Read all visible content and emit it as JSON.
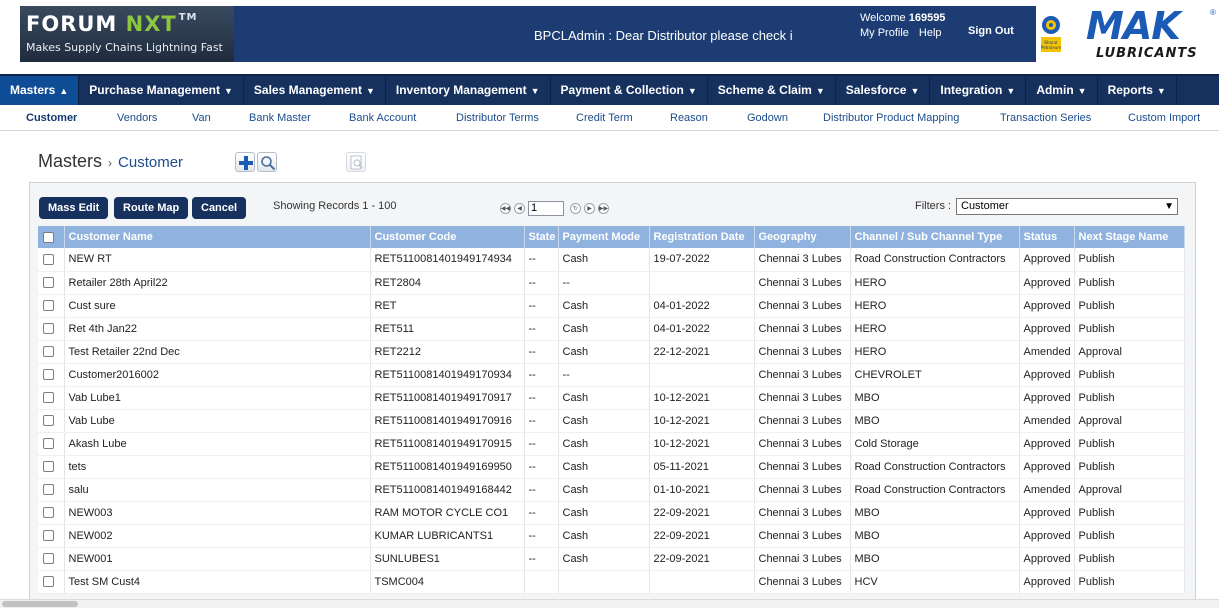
{
  "header": {
    "brand_main": "FORUM",
    "brand_accent": "NXT",
    "brand_tm": "TM",
    "brand_tagline": "Makes Supply Chains Lightning Fast",
    "marquee": "BPCLAdmin : Dear Distributor please check i",
    "welcome_prefix": "Welcome",
    "user_id": "169595",
    "my_profile": "My Profile",
    "help": "Help",
    "sign_out": "Sign Out",
    "partner_logo_text": "MAK",
    "partner_logo_sub": "LUBRICANTS",
    "partner_reg": "®",
    "bp_logo_text": "Bharat Petroleum"
  },
  "main_nav": [
    {
      "label": "Masters",
      "caret": "▲",
      "active": true
    },
    {
      "label": "Purchase Management",
      "caret": "▼"
    },
    {
      "label": "Sales Management",
      "caret": "▼"
    },
    {
      "label": "Inventory Management",
      "caret": "▼"
    },
    {
      "label": "Payment & Collection",
      "caret": "▼"
    },
    {
      "label": "Scheme & Claim",
      "caret": "▼"
    },
    {
      "label": "Salesforce",
      "caret": "▼"
    },
    {
      "label": "Integration",
      "caret": "▼"
    },
    {
      "label": "Admin",
      "caret": "▼"
    },
    {
      "label": "Reports",
      "caret": "▼"
    }
  ],
  "sub_nav": [
    {
      "label": "Customer",
      "active": true
    },
    {
      "label": "Vendors"
    },
    {
      "label": "Van"
    },
    {
      "label": "Bank Master"
    },
    {
      "label": "Bank Account"
    },
    {
      "label": "Distributor Terms"
    },
    {
      "label": "Credit Term"
    },
    {
      "label": "Reason"
    },
    {
      "label": "Godown"
    },
    {
      "label": "Distributor Product Mapping"
    },
    {
      "label": "Transaction Series"
    },
    {
      "label": "Custom Import"
    }
  ],
  "breadcrumb": {
    "root": "Masters",
    "arrow": "›",
    "current": "Customer"
  },
  "toolbar": {
    "mass_edit": "Mass Edit",
    "route_map": "Route Map",
    "cancel": "Cancel",
    "records": "Showing Records 1 - 100",
    "page": "1",
    "filters_label": "Filters :",
    "filter_value": "Customer"
  },
  "columns": [
    "Customer Name",
    "Customer Code",
    "State",
    "Payment Mode",
    "Registration Date",
    "Geography",
    "Channel / Sub Channel Type",
    "Status",
    "Next Stage Name"
  ],
  "rows": [
    [
      "NEW RT",
      "RET5110081401949174934",
      "--",
      "Cash",
      "19-07-2022",
      "Chennai 3 Lubes",
      "Road Construction Contractors",
      "Approved",
      "Publish"
    ],
    [
      "Retailer 28th April22",
      "RET2804",
      "--",
      "--",
      "",
      "Chennai 3 Lubes",
      "HERO",
      "Approved",
      "Publish"
    ],
    [
      "Cust sure",
      "RET",
      "--",
      "Cash",
      "04-01-2022",
      "Chennai 3 Lubes",
      "HERO",
      "Approved",
      "Publish"
    ],
    [
      "Ret 4th Jan22",
      "RET511",
      "--",
      "Cash",
      "04-01-2022",
      "Chennai 3 Lubes",
      "HERO",
      "Approved",
      "Publish"
    ],
    [
      "Test Retailer 22nd Dec",
      "RET2212",
      "--",
      "Cash",
      "22-12-2021",
      "Chennai 3 Lubes",
      "HERO",
      "Amended",
      "Approval"
    ],
    [
      "Customer2016002",
      "RET5110081401949170934",
      "--",
      "--",
      "",
      "Chennai 3 Lubes",
      "CHEVROLET",
      "Approved",
      "Publish"
    ],
    [
      "Vab Lube1",
      "RET5110081401949170917",
      "--",
      "Cash",
      "10-12-2021",
      "Chennai 3 Lubes",
      "MBO",
      "Approved",
      "Publish"
    ],
    [
      "Vab Lube",
      "RET5110081401949170916",
      "--",
      "Cash",
      "10-12-2021",
      "Chennai 3 Lubes",
      "MBO",
      "Amended",
      "Approval"
    ],
    [
      "Akash Lube",
      "RET5110081401949170915",
      "--",
      "Cash",
      "10-12-2021",
      "Chennai 3 Lubes",
      "Cold Storage",
      "Approved",
      "Publish"
    ],
    [
      "tets",
      "RET5110081401949169950",
      "--",
      "Cash",
      "05-11-2021",
      "Chennai 3 Lubes",
      "Road Construction Contractors",
      "Approved",
      "Publish"
    ],
    [
      "salu",
      "RET5110081401949168442",
      "--",
      "Cash",
      "01-10-2021",
      "Chennai 3 Lubes",
      "Road Construction Contractors",
      "Amended",
      "Approval"
    ],
    [
      "NEW003",
      "RAM MOTOR CYCLE CO1",
      "--",
      "Cash",
      "22-09-2021",
      "Chennai 3 Lubes",
      "MBO",
      "Approved",
      "Publish"
    ],
    [
      "NEW002",
      "KUMAR LUBRICANTS1",
      "--",
      "Cash",
      "22-09-2021",
      "Chennai 3 Lubes",
      "MBO",
      "Approved",
      "Publish"
    ],
    [
      "NEW001",
      "SUNLUBES1",
      "--",
      "Cash",
      "22-09-2021",
      "Chennai 3 Lubes",
      "MBO",
      "Approved",
      "Publish"
    ],
    [
      "Test SM Cust4",
      "TSMC004",
      "",
      "",
      "",
      "Chennai 3 Lubes",
      "HCV",
      "Approved",
      "Publish"
    ]
  ],
  "colors": {
    "nav_bg": "#17315f",
    "header_row": "#8fb3de",
    "accent_link": "#1c4c8c",
    "brand_green": "#8dc63f",
    "mak_blue": "#1c5bb5"
  }
}
